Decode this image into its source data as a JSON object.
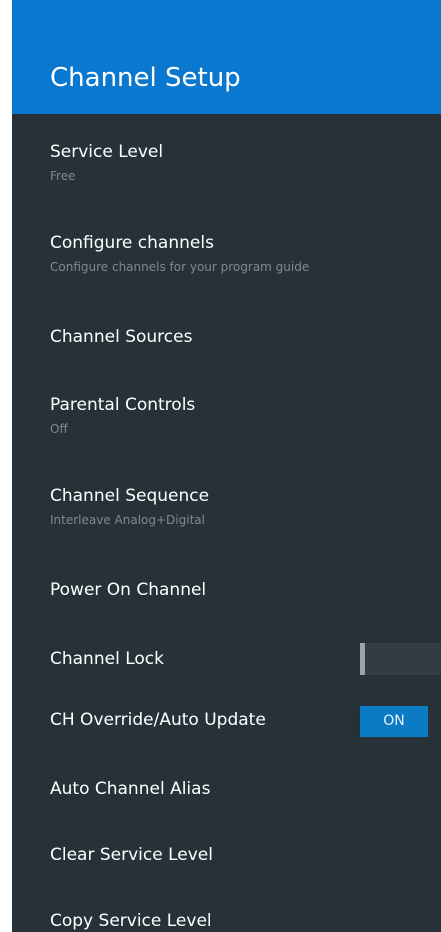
{
  "header": {
    "title": "Channel Setup"
  },
  "settings": {
    "items": [
      {
        "title": "Service Level",
        "subtitle": "Free"
      },
      {
        "title": "Configure channels",
        "subtitle": "Configure channels for your program guide"
      },
      {
        "title": "Channel Sources"
      },
      {
        "title": "Parental Controls",
        "subtitle": "Off"
      },
      {
        "title": "Channel Sequence",
        "subtitle": "Interleave Analog+Digital"
      },
      {
        "title": "Power On Channel"
      },
      {
        "title": "Channel Lock",
        "toggle": "off"
      },
      {
        "title": "CH Override/Auto Update",
        "toggle": "on",
        "toggle_label": "ON"
      },
      {
        "title": "Auto Channel Alias"
      },
      {
        "title": "Clear Service Level"
      },
      {
        "title": "Copy Service Level"
      }
    ]
  },
  "colors": {
    "header_bg": "#0b78d0",
    "panel_bg": "#263238",
    "accent": "#0b7bc6"
  }
}
